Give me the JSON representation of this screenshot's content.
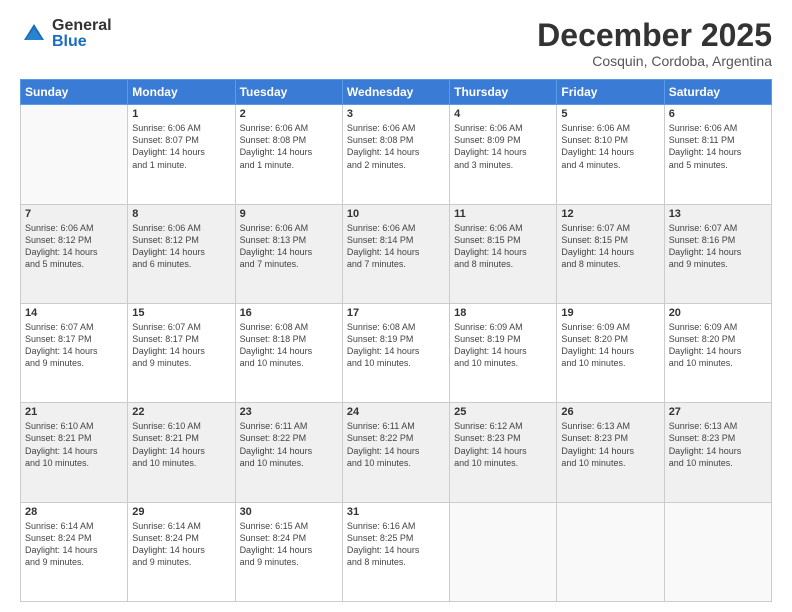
{
  "logo": {
    "general": "General",
    "blue": "Blue"
  },
  "title": "December 2025",
  "subtitle": "Cosquin, Cordoba, Argentina",
  "weekdays": [
    "Sunday",
    "Monday",
    "Tuesday",
    "Wednesday",
    "Thursday",
    "Friday",
    "Saturday"
  ],
  "weeks": [
    [
      {
        "day": "",
        "info": ""
      },
      {
        "day": "1",
        "info": "Sunrise: 6:06 AM\nSunset: 8:07 PM\nDaylight: 14 hours\nand 1 minute."
      },
      {
        "day": "2",
        "info": "Sunrise: 6:06 AM\nSunset: 8:08 PM\nDaylight: 14 hours\nand 1 minute."
      },
      {
        "day": "3",
        "info": "Sunrise: 6:06 AM\nSunset: 8:08 PM\nDaylight: 14 hours\nand 2 minutes."
      },
      {
        "day": "4",
        "info": "Sunrise: 6:06 AM\nSunset: 8:09 PM\nDaylight: 14 hours\nand 3 minutes."
      },
      {
        "day": "5",
        "info": "Sunrise: 6:06 AM\nSunset: 8:10 PM\nDaylight: 14 hours\nand 4 minutes."
      },
      {
        "day": "6",
        "info": "Sunrise: 6:06 AM\nSunset: 8:11 PM\nDaylight: 14 hours\nand 5 minutes."
      }
    ],
    [
      {
        "day": "7",
        "info": "Sunrise: 6:06 AM\nSunset: 8:12 PM\nDaylight: 14 hours\nand 5 minutes."
      },
      {
        "day": "8",
        "info": "Sunrise: 6:06 AM\nSunset: 8:12 PM\nDaylight: 14 hours\nand 6 minutes."
      },
      {
        "day": "9",
        "info": "Sunrise: 6:06 AM\nSunset: 8:13 PM\nDaylight: 14 hours\nand 7 minutes."
      },
      {
        "day": "10",
        "info": "Sunrise: 6:06 AM\nSunset: 8:14 PM\nDaylight: 14 hours\nand 7 minutes."
      },
      {
        "day": "11",
        "info": "Sunrise: 6:06 AM\nSunset: 8:15 PM\nDaylight: 14 hours\nand 8 minutes."
      },
      {
        "day": "12",
        "info": "Sunrise: 6:07 AM\nSunset: 8:15 PM\nDaylight: 14 hours\nand 8 minutes."
      },
      {
        "day": "13",
        "info": "Sunrise: 6:07 AM\nSunset: 8:16 PM\nDaylight: 14 hours\nand 9 minutes."
      }
    ],
    [
      {
        "day": "14",
        "info": "Sunrise: 6:07 AM\nSunset: 8:17 PM\nDaylight: 14 hours\nand 9 minutes."
      },
      {
        "day": "15",
        "info": "Sunrise: 6:07 AM\nSunset: 8:17 PM\nDaylight: 14 hours\nand 9 minutes."
      },
      {
        "day": "16",
        "info": "Sunrise: 6:08 AM\nSunset: 8:18 PM\nDaylight: 14 hours\nand 10 minutes."
      },
      {
        "day": "17",
        "info": "Sunrise: 6:08 AM\nSunset: 8:19 PM\nDaylight: 14 hours\nand 10 minutes."
      },
      {
        "day": "18",
        "info": "Sunrise: 6:09 AM\nSunset: 8:19 PM\nDaylight: 14 hours\nand 10 minutes."
      },
      {
        "day": "19",
        "info": "Sunrise: 6:09 AM\nSunset: 8:20 PM\nDaylight: 14 hours\nand 10 minutes."
      },
      {
        "day": "20",
        "info": "Sunrise: 6:09 AM\nSunset: 8:20 PM\nDaylight: 14 hours\nand 10 minutes."
      }
    ],
    [
      {
        "day": "21",
        "info": "Sunrise: 6:10 AM\nSunset: 8:21 PM\nDaylight: 14 hours\nand 10 minutes."
      },
      {
        "day": "22",
        "info": "Sunrise: 6:10 AM\nSunset: 8:21 PM\nDaylight: 14 hours\nand 10 minutes."
      },
      {
        "day": "23",
        "info": "Sunrise: 6:11 AM\nSunset: 8:22 PM\nDaylight: 14 hours\nand 10 minutes."
      },
      {
        "day": "24",
        "info": "Sunrise: 6:11 AM\nSunset: 8:22 PM\nDaylight: 14 hours\nand 10 minutes."
      },
      {
        "day": "25",
        "info": "Sunrise: 6:12 AM\nSunset: 8:23 PM\nDaylight: 14 hours\nand 10 minutes."
      },
      {
        "day": "26",
        "info": "Sunrise: 6:13 AM\nSunset: 8:23 PM\nDaylight: 14 hours\nand 10 minutes."
      },
      {
        "day": "27",
        "info": "Sunrise: 6:13 AM\nSunset: 8:23 PM\nDaylight: 14 hours\nand 10 minutes."
      }
    ],
    [
      {
        "day": "28",
        "info": "Sunrise: 6:14 AM\nSunset: 8:24 PM\nDaylight: 14 hours\nand 9 minutes."
      },
      {
        "day": "29",
        "info": "Sunrise: 6:14 AM\nSunset: 8:24 PM\nDaylight: 14 hours\nand 9 minutes."
      },
      {
        "day": "30",
        "info": "Sunrise: 6:15 AM\nSunset: 8:24 PM\nDaylight: 14 hours\nand 9 minutes."
      },
      {
        "day": "31",
        "info": "Sunrise: 6:16 AM\nSunset: 8:25 PM\nDaylight: 14 hours\nand 8 minutes."
      },
      {
        "day": "",
        "info": ""
      },
      {
        "day": "",
        "info": ""
      },
      {
        "day": "",
        "info": ""
      }
    ]
  ]
}
